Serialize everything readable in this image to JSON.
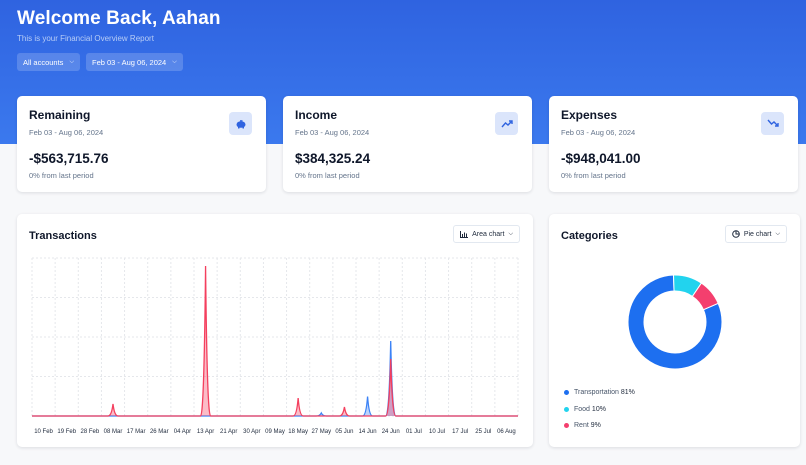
{
  "header": {
    "title": "Welcome Back, Aahan",
    "subtitle": "This is your Financial Overview Report",
    "accounts_filter": "All accounts",
    "date_filter": "Feb 03 - Aug 06, 2024"
  },
  "stats": [
    {
      "title": "Remaining",
      "range": "Feb 03 - Aug 06, 2024",
      "value": "-$563,715.76",
      "change": "0% from last period",
      "icon": "piggy-bank-icon"
    },
    {
      "title": "Income",
      "range": "Feb 03 - Aug 06, 2024",
      "value": "$384,325.24",
      "change": "0% from last period",
      "icon": "trending-up-icon"
    },
    {
      "title": "Expenses",
      "range": "Feb 03 - Aug 06, 2024",
      "value": "-$948,041.00",
      "change": "0% from last period",
      "icon": "trending-down-icon"
    }
  ],
  "transactions": {
    "title": "Transactions",
    "chart_type_button": "Area chart"
  },
  "categories": {
    "title": "Categories",
    "chart_type_button": "Pie chart",
    "legend": [
      {
        "name": "Transportation",
        "pct": "81%"
      },
      {
        "name": "Food",
        "pct": "10%"
      },
      {
        "name": "Rent",
        "pct": "9%"
      }
    ]
  },
  "colors": {
    "accent": "#2f63e0",
    "income": "#3b82f6",
    "expenses": "#f43f5e",
    "transportation": "#1d6ff0",
    "food": "#22d3ee",
    "rent": "#f43f6e"
  },
  "chart_data": [
    {
      "type": "area",
      "x": [
        "10 Feb",
        "19 Feb",
        "28 Feb",
        "08 Mar",
        "17 Mar",
        "26 Mar",
        "04 Apr",
        "13 Apr",
        "21 Apr",
        "30 Apr",
        "09 May",
        "18 May",
        "27 May",
        "05 Jun",
        "14 Jun",
        "24 Jun",
        "01 Jul",
        "10 Jul",
        "17 Jul",
        "25 Jul",
        "06 Aug"
      ],
      "series": [
        {
          "color": "#3b82f6",
          "spikes": [
            {
              "at": "27 May",
              "value": 0.02
            },
            {
              "at": "14 Jun",
              "value": 0.13
            },
            {
              "at": "24 Jun",
              "value": 0.5
            }
          ]
        },
        {
          "color": "#f43f5e",
          "spikes": [
            {
              "at": "08 Mar",
              "value": 0.08
            },
            {
              "at": "13 Apr",
              "value": 1.0
            },
            {
              "at": "18 May",
              "value": 0.12
            },
            {
              "at": "05 Jun",
              "value": 0.06
            },
            {
              "at": "24 Jun",
              "value": 0.38
            }
          ]
        }
      ],
      "grid": true,
      "title": "Transactions"
    },
    {
      "type": "pie",
      "categories": [
        "Transportation",
        "Food",
        "Rent"
      ],
      "values": [
        81,
        10,
        9
      ],
      "title": "Categories"
    }
  ]
}
